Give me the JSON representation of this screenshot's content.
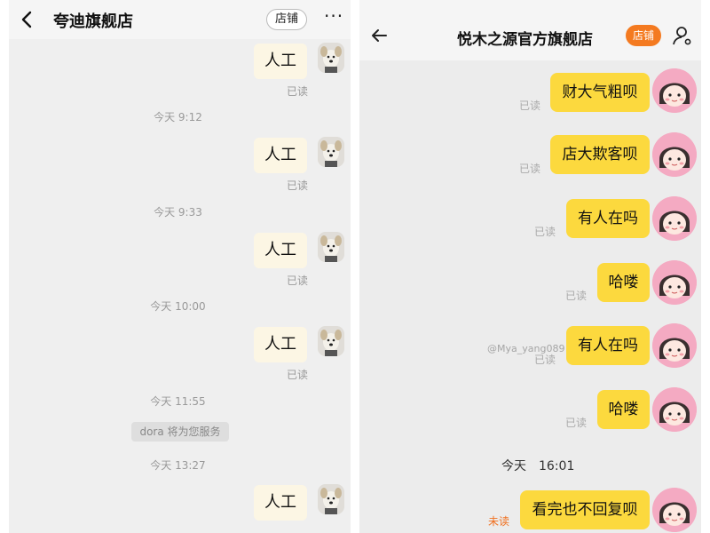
{
  "left": {
    "header": {
      "title": "夸迪旗舰店",
      "store_button": "店铺",
      "more": "···"
    },
    "messages": [
      {
        "text": "人工",
        "status": "已读"
      },
      {
        "text": "人工",
        "status": "已读"
      },
      {
        "text": "人工",
        "status": "已读"
      },
      {
        "text": "人工",
        "status": "已读"
      },
      {
        "text": "人工",
        "status": ""
      }
    ],
    "timestamps": [
      "今天 9:12",
      "今天 9:33",
      "今天 10:00",
      "今天 11:55",
      "今天 13:27"
    ],
    "system_notice": "dora 将为您服务"
  },
  "right": {
    "header": {
      "title": "悦木之源官方旗舰店",
      "store_button": "店铺"
    },
    "messages": [
      {
        "text": "财大气粗呗",
        "status": "已读"
      },
      {
        "text": "店大欺客呗",
        "status": "已读"
      },
      {
        "text": "有人在吗",
        "status": "已读"
      },
      {
        "text": "哈喽",
        "status": "已读"
      },
      {
        "text": "有人在吗",
        "status": "已读"
      },
      {
        "text": "哈喽",
        "status": "已读"
      },
      {
        "text": "看完也不回复呗",
        "status": "未读"
      }
    ],
    "timestamp": "今天　16:01",
    "watermark": "@Mya_yang089"
  },
  "colors": {
    "left_bubble": "#fcf6e4",
    "right_bubble": "#fcd93e",
    "store_orange": "#f47a20",
    "unread": "#f07020"
  },
  "icons": [
    "back-arrow-icon",
    "more-dots-icon",
    "user-settings-icon",
    "dog-avatar",
    "girl-avatar"
  ]
}
